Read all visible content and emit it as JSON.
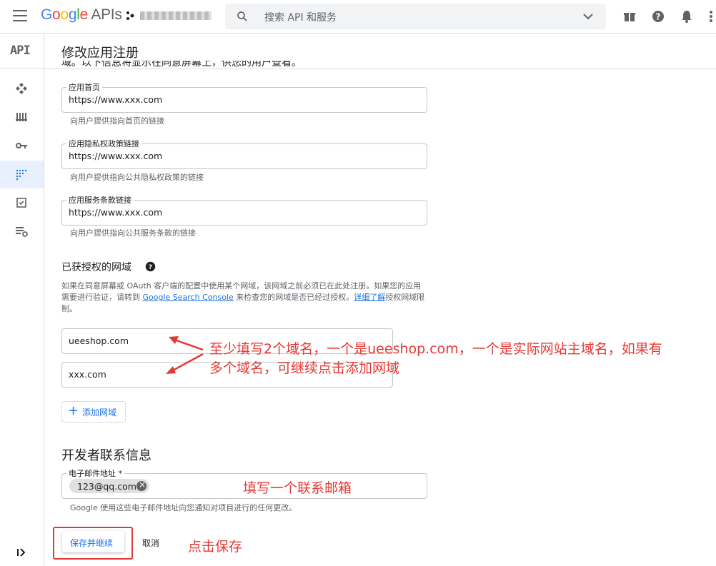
{
  "topbar": {
    "logo_google": "Google",
    "logo_apis": "APIs",
    "search_placeholder": "搜索 API 和服务"
  },
  "rail": {
    "api_label": "API"
  },
  "page": {
    "title": "修改应用注册",
    "cut_text": "域。以下信息将显示在同意屏幕上，供您的用户查看。"
  },
  "fields": [
    {
      "label": "应用首页",
      "value": "https://www.xxx.com",
      "hint": "向用户提供指向首页的链接"
    },
    {
      "label": "应用隐私权政策链接",
      "value": "https://www.xxx.com",
      "hint": "向用户提供指向公共隐私权政策的链接"
    },
    {
      "label": "应用服务条款链接",
      "value": "https://www.xxx.com",
      "hint": "向用户提供指向公共服务条款的链接"
    }
  ],
  "authorized": {
    "title": "已获授权的网域",
    "desc_1": "如果在同意屏幕或 OAuth 客户端的配置中使用某个网域，该网域之前必须已在此处注册。如果您的应用需要进行验证，请转到 ",
    "desc_link1": "Google Search Console",
    "desc_2": " 来检查您的网域是否已经过授权。",
    "desc_link2": "详细了解",
    "desc_3": "授权网域限制。",
    "domains": [
      "ueeshop.com",
      "xxx.com"
    ],
    "add_label": "添加网域"
  },
  "developer": {
    "title": "开发者联系信息",
    "email_label": "电子邮件地址 *",
    "email_chip": "123@qq.com",
    "hint": "Google 使用这些电子邮件地址向您通知对项目进行的任何更改。"
  },
  "actions": {
    "save": "保存并继续",
    "cancel": "取消"
  },
  "annotations": {
    "domains_note_line1": "至少填写2个域名，一个是ueeshop.com，一个是实际网站主域名，如果有",
    "domains_note_line2": "多个域名，可继续点击添加网域",
    "email_note": "填写一个联系邮箱",
    "save_note": "点击保存"
  },
  "colors": {
    "accent": "#1a73e8",
    "annotation": "#e53935"
  }
}
